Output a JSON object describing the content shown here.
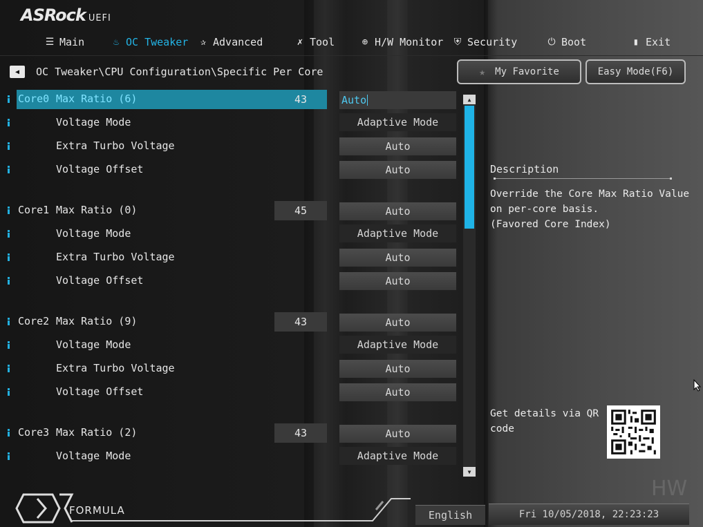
{
  "brand": {
    "name": "ASRock",
    "suffix": "UEFI"
  },
  "nav": [
    {
      "label": "Main",
      "icon": "list-icon",
      "active": false
    },
    {
      "label": "OC Tweaker",
      "icon": "flame-icon",
      "active": true
    },
    {
      "label": "Advanced",
      "icon": "star-icon",
      "active": false
    },
    {
      "label": "Tool",
      "icon": "tools-icon",
      "active": false
    },
    {
      "label": "H/W Monitor",
      "icon": "monitor-icon",
      "active": false
    },
    {
      "label": "Security",
      "icon": "shield-icon",
      "active": false
    },
    {
      "label": "Boot",
      "icon": "power-icon",
      "active": false
    },
    {
      "label": "Exit",
      "icon": "exit-icon",
      "active": false
    }
  ],
  "breadcrumb": "OC Tweaker\\CPU Configuration\\Specific Per Core",
  "buttons": {
    "favorite": "My Favorite",
    "easy_mode": "Easy Mode(F6)"
  },
  "cores": [
    {
      "core": "Core0",
      "max_ratio_label": "Max Ratio  (6)",
      "ratio": "43",
      "values": {
        "max_ratio": "Auto",
        "voltage_mode": "Adaptive Mode",
        "extra_turbo": "Auto",
        "offset": "Auto"
      }
    },
    {
      "core": "Core1",
      "max_ratio_label": "Max Ratio  (0)",
      "ratio": "45",
      "values": {
        "max_ratio": "Auto",
        "voltage_mode": "Adaptive Mode",
        "extra_turbo": "Auto",
        "offset": "Auto"
      }
    },
    {
      "core": "Core2",
      "max_ratio_label": "Max Ratio  (9)",
      "ratio": "43",
      "values": {
        "max_ratio": "Auto",
        "voltage_mode": "Adaptive Mode",
        "extra_turbo": "Auto",
        "offset": "Auto"
      }
    },
    {
      "core": "Core3",
      "max_ratio_label": "Max Ratio  (2)",
      "ratio": "43",
      "values": {
        "max_ratio": "Auto",
        "voltage_mode": "Adaptive Mode"
      }
    }
  ],
  "sub_labels": {
    "voltage_mode": "Voltage Mode",
    "extra_turbo": "Extra Turbo Voltage",
    "offset": "Voltage Offset"
  },
  "description": {
    "title": "Description",
    "text": "Override the Core Max Ratio Value\non per-core basis.\n(Favored Core Index)",
    "qr_text": "Get details via QR code"
  },
  "footer": {
    "formula": "FORMULA",
    "language": "English",
    "datetime": "Fri 10/05/2018, 22:23:23",
    "watermark": "HW"
  },
  "colors": {
    "accent": "#23b4e6",
    "selected_row": "#1e87a0"
  }
}
